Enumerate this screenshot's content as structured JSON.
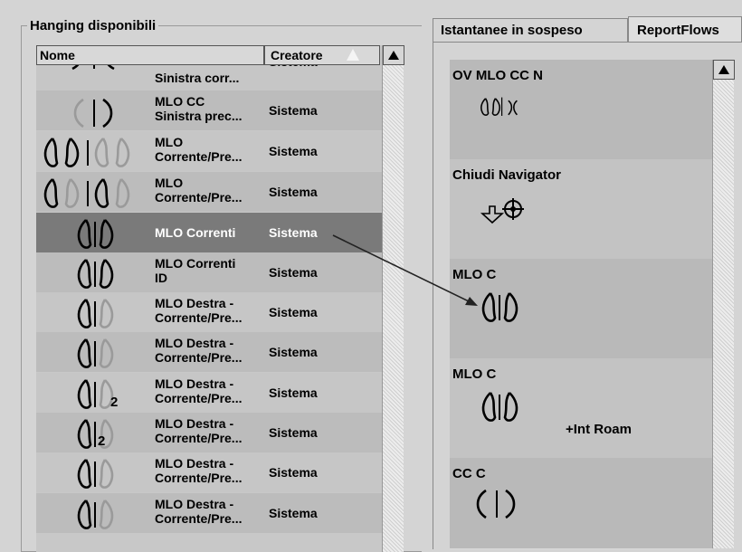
{
  "left_panel": {
    "title": "Hanging disponibili",
    "columns": {
      "name": "Nome",
      "creator": "Creatore"
    },
    "rows": [
      {
        "name": "Sinistra corr...",
        "creator": "Sistema",
        "icon": "partial-breast-icon"
      },
      {
        "name": "MLO CC\nSinistra prec...",
        "creator": "Sistema",
        "icon": "cc-breast-pair-icon"
      },
      {
        "name": "MLO\nCorrente/Pre...",
        "creator": "Sistema",
        "icon": "mlo-four-breast-icon"
      },
      {
        "name": "MLO\nCorrente/Pre...",
        "creator": "Sistema",
        "icon": "mlo-four-breast-icon"
      },
      {
        "name": "MLO Correnti",
        "creator": "Sistema",
        "icon": "mlo-breast-pair-icon",
        "selected": true
      },
      {
        "name": "MLO Correnti\nID",
        "creator": "Sistema",
        "icon": "mlo-breast-pair-icon"
      },
      {
        "name": "MLO Destra -\nCorrente/Pre...",
        "creator": "Sistema",
        "icon": "mlo-breast-pair-icon"
      },
      {
        "name": "MLO Destra -\nCorrente/Pre...",
        "creator": "Sistema",
        "icon": "mlo-breast-pair-icon"
      },
      {
        "name": "MLO Destra -\nCorrente/Pre...",
        "creator": "Sistema",
        "icon": "mlo-breast-pair-2-icon",
        "badge": "2"
      },
      {
        "name": "MLO Destra -\nCorrente/Pre...",
        "creator": "Sistema",
        "icon": "mlo-breast-pair-2-icon",
        "badge": "2"
      },
      {
        "name": "MLO Destra -\nCorrente/Pre...",
        "creator": "Sistema",
        "icon": "mlo-breast-pair-icon"
      },
      {
        "name": "MLO Destra -\nCorrente/Pre...",
        "creator": "Sistema",
        "icon": "mlo-breast-pair-icon"
      }
    ]
  },
  "right_panel": {
    "tabs": [
      "Istantanee in sospeso",
      "ReportFlows"
    ],
    "active_tab": "ReportFlows",
    "flows": [
      {
        "title": "OV MLO CC N",
        "icon": "ov-mlo-cc-icon"
      },
      {
        "title": "Chiudi Navigator",
        "icon": "navigator-icon"
      },
      {
        "title": "MLO C",
        "icon": "mlo-breast-pair-icon"
      },
      {
        "title": "MLO C",
        "icon": "mlo-breast-pair-icon",
        "extra": "+Int Roam"
      },
      {
        "title": "CC C",
        "icon": "cc-breast-pair-icon"
      }
    ]
  },
  "colors": {
    "selected_row": "#7a7a7a",
    "background": "#d4d4d4"
  }
}
